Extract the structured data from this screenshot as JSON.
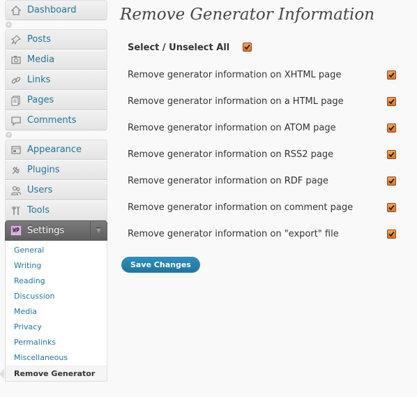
{
  "sidebar": {
    "top": [
      {
        "label": "Dashboard",
        "icon": "dashboard-icon"
      }
    ],
    "content": [
      {
        "label": "Posts",
        "icon": "pin-icon"
      },
      {
        "label": "Media",
        "icon": "media-icon"
      },
      {
        "label": "Links",
        "icon": "link-icon"
      },
      {
        "label": "Pages",
        "icon": "pages-icon"
      },
      {
        "label": "Comments",
        "icon": "comment-icon"
      }
    ],
    "admin": [
      {
        "label": "Appearance",
        "icon": "appearance-icon"
      },
      {
        "label": "Plugins",
        "icon": "plugin-icon"
      },
      {
        "label": "Users",
        "icon": "users-icon"
      },
      {
        "label": "Tools",
        "icon": "tools-icon"
      }
    ],
    "settings": {
      "label": "Settings",
      "icon": "settings-icon",
      "icon_text": "WP",
      "submenu": [
        {
          "label": "General"
        },
        {
          "label": "Writing"
        },
        {
          "label": "Reading"
        },
        {
          "label": "Discussion"
        },
        {
          "label": "Media"
        },
        {
          "label": "Privacy"
        },
        {
          "label": "Permalinks"
        },
        {
          "label": "Miscellaneous"
        },
        {
          "label": "Remove Generator",
          "active": true
        }
      ]
    },
    "separator_glyph": "«"
  },
  "main": {
    "title": "Remove Generator Information",
    "select_all_label": "Select / Unselect All",
    "options": [
      {
        "label": "Remove generator information on XHTML page",
        "checked": true
      },
      {
        "label": "Remove generator information on a HTML page",
        "checked": true
      },
      {
        "label": "Remove generator information on ATOM page",
        "checked": true
      },
      {
        "label": "Remove generator information on RSS2 page",
        "checked": true
      },
      {
        "label": "Remove generator information on RDF page",
        "checked": true
      },
      {
        "label": "Remove generator information on comment page",
        "checked": true
      },
      {
        "label": "Remove generator information on \"export\" file",
        "checked": true
      }
    ],
    "save_label": "Save Changes"
  },
  "colors": {
    "link": "#21759b",
    "checkbox_fill": "#e07320",
    "button": "#21759b"
  }
}
